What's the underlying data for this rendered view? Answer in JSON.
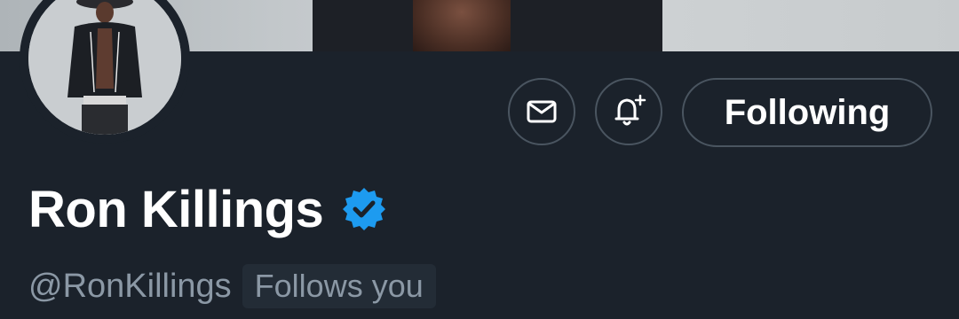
{
  "profile": {
    "display_name": "Ron Killings",
    "handle": "@RonKillings",
    "follows_you_label": "Follows you",
    "verified": true,
    "avatar_icon": "profile-photo",
    "banner_icon": "banner-photo"
  },
  "actions": {
    "message_icon": "envelope-icon",
    "notify_icon": "bell-plus-icon",
    "following_label": "Following"
  },
  "colors": {
    "background": "#1b222b",
    "verified_blue": "#1d9bf0",
    "muted_text": "#8b98a5",
    "border": "#4a5560"
  }
}
